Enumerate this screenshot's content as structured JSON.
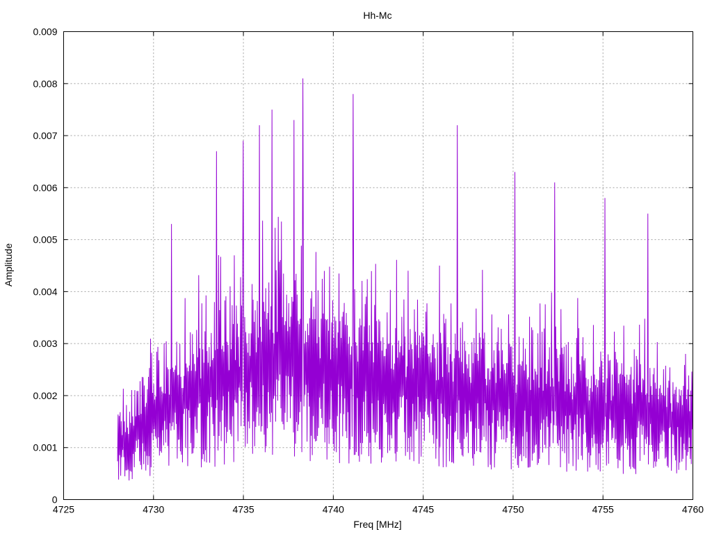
{
  "chart_data": {
    "type": "line",
    "title": "Hh-Mc",
    "xlabel": "Freq [MHz]",
    "ylabel": "Amplitude",
    "xlim": [
      4725,
      4760
    ],
    "ylim": [
      0,
      0.009
    ],
    "xticks": [
      "4725",
      "4730",
      "4735",
      "4740",
      "4745",
      "4750",
      "4755",
      "4760"
    ],
    "yticks": [
      "0",
      "0.001",
      "0.002",
      "0.003",
      "0.004",
      "0.005",
      "0.006",
      "0.007",
      "0.008",
      "0.009"
    ],
    "grid": true,
    "series": [
      {
        "color": "#9400d3",
        "x_range": [
          4728.0,
          4760.0
        ],
        "point_count": 1100,
        "peaks": [
          {
            "x": 4731.0,
            "y": 0.0053
          },
          {
            "x": 4733.5,
            "y": 0.0067
          },
          {
            "x": 4735.0,
            "y": 0.0069
          },
          {
            "x": 4735.9,
            "y": 0.0072
          },
          {
            "x": 4736.6,
            "y": 0.0075
          },
          {
            "x": 4737.8,
            "y": 0.0073
          },
          {
            "x": 4738.3,
            "y": 0.0081
          },
          {
            "x": 4741.1,
            "y": 0.0078
          },
          {
            "x": 4746.9,
            "y": 0.0072
          },
          {
            "x": 4750.1,
            "y": 0.0063
          },
          {
            "x": 4752.3,
            "y": 0.0061
          },
          {
            "x": 4755.1,
            "y": 0.0058
          },
          {
            "x": 4757.5,
            "y": 0.0055
          }
        ]
      }
    ]
  }
}
